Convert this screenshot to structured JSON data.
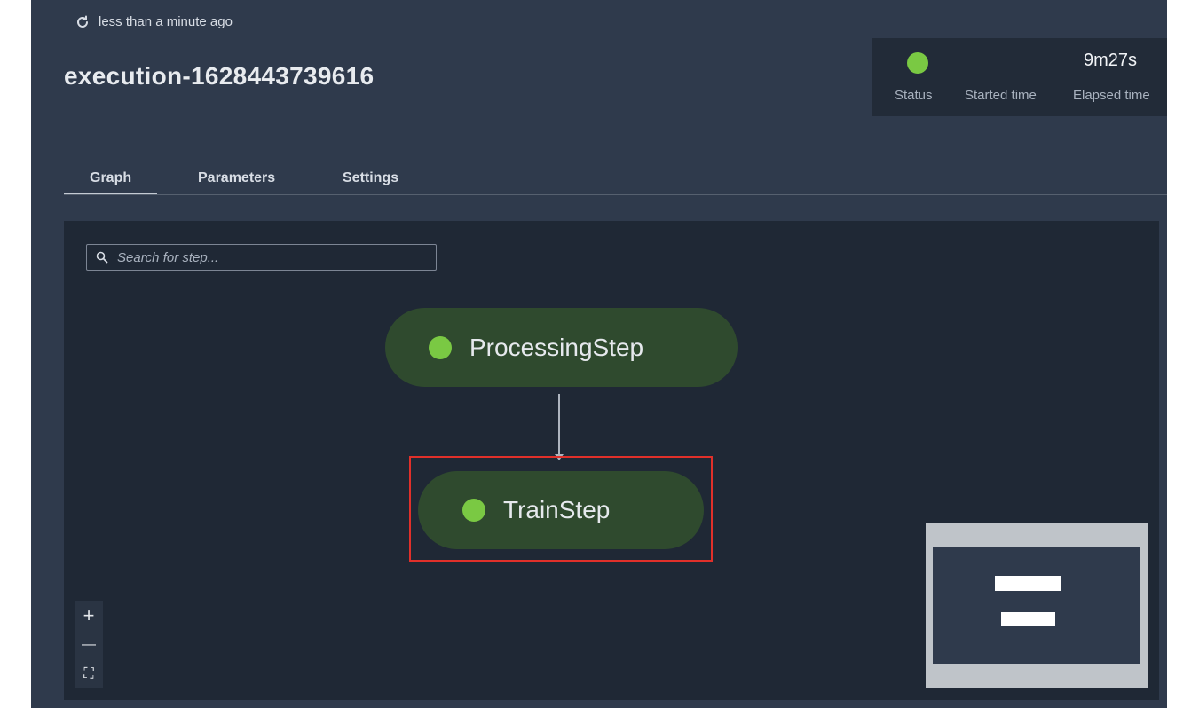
{
  "refresh": {
    "text": "less than a minute ago",
    "icon": "refresh-icon"
  },
  "execution": {
    "title": "execution-1628443739616"
  },
  "status_panel": {
    "status_label": "Status",
    "status_color": "#7ac943",
    "started_label": "Started time",
    "started_value": "",
    "elapsed_label": "Elapsed time",
    "elapsed_value": "9m27s"
  },
  "tabs": [
    {
      "label": "Graph",
      "active": true
    },
    {
      "label": "Parameters",
      "active": false
    },
    {
      "label": "Settings",
      "active": false
    }
  ],
  "graph": {
    "search": {
      "placeholder": "Search for step...",
      "value": ""
    },
    "steps": [
      {
        "label": "ProcessingStep",
        "status_color": "#7ac943"
      },
      {
        "label": "TrainStep",
        "status_color": "#7ac943",
        "highlighted": true
      }
    ],
    "highlight_color": "#e0302a",
    "zoom_controls": [
      {
        "icon": "plus-icon",
        "glyph": "+"
      },
      {
        "icon": "minus-icon",
        "glyph": "—"
      },
      {
        "icon": "fit-screen-icon",
        "glyph": "⛶"
      }
    ]
  }
}
